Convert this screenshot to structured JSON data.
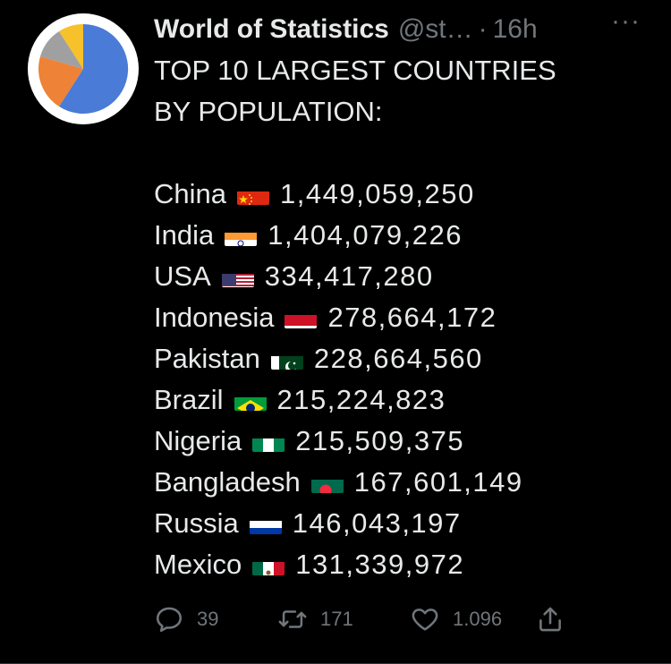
{
  "tweet": {
    "author_name": "World of Statistics",
    "handle": "@st…",
    "separator": "·",
    "time": "16h",
    "more": "···",
    "headline_line1": "TOP 10 LARGEST COUNTRIES",
    "headline_line2": "BY POPULATION:",
    "rows": [
      {
        "country": "China",
        "flag": "china-flag-icon",
        "population": "1,449,059,250"
      },
      {
        "country": "India",
        "flag": "india-flag-icon",
        "population": "1,404,079,226"
      },
      {
        "country": "USA",
        "flag": "usa-flag-icon",
        "population": "334,417,280"
      },
      {
        "country": "Indonesia",
        "flag": "indonesia-flag-icon",
        "population": "278,664,172"
      },
      {
        "country": "Pakistan",
        "flag": "pakistan-flag-icon",
        "population": "228,664,560"
      },
      {
        "country": "Brazil",
        "flag": "brazil-flag-icon",
        "population": "215,224,823"
      },
      {
        "country": "Nigeria",
        "flag": "nigeria-flag-icon",
        "population": "215,509,375"
      },
      {
        "country": "Bangladesh",
        "flag": "bangladesh-flag-icon",
        "population": "167,601,149"
      },
      {
        "country": "Russia",
        "flag": "russia-flag-icon",
        "population": "146,043,197"
      },
      {
        "country": "Mexico",
        "flag": "mexico-flag-icon",
        "population": "131,339,972"
      }
    ],
    "actions": {
      "replies": "39",
      "retweets": "171",
      "likes": "1.096"
    }
  },
  "colors": {
    "background": "#000000",
    "text": "#e7e9ea",
    "muted": "#71767b"
  }
}
